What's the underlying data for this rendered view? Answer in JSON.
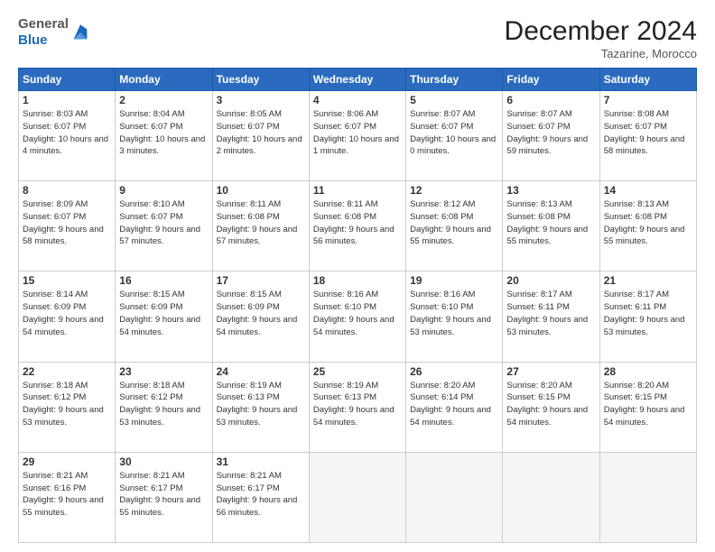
{
  "header": {
    "logo_line1": "General",
    "logo_line2": "Blue",
    "month": "December 2024",
    "location": "Tazarine, Morocco"
  },
  "weekdays": [
    "Sunday",
    "Monday",
    "Tuesday",
    "Wednesday",
    "Thursday",
    "Friday",
    "Saturday"
  ],
  "weeks": [
    [
      {
        "day": 1,
        "sunrise": "8:03 AM",
        "sunset": "6:07 PM",
        "daylight": "10 hours and 4 minutes."
      },
      {
        "day": 2,
        "sunrise": "8:04 AM",
        "sunset": "6:07 PM",
        "daylight": "10 hours and 3 minutes."
      },
      {
        "day": 3,
        "sunrise": "8:05 AM",
        "sunset": "6:07 PM",
        "daylight": "10 hours and 2 minutes."
      },
      {
        "day": 4,
        "sunrise": "8:06 AM",
        "sunset": "6:07 PM",
        "daylight": "10 hours and 1 minute."
      },
      {
        "day": 5,
        "sunrise": "8:07 AM",
        "sunset": "6:07 PM",
        "daylight": "10 hours and 0 minutes."
      },
      {
        "day": 6,
        "sunrise": "8:07 AM",
        "sunset": "6:07 PM",
        "daylight": "9 hours and 59 minutes."
      },
      {
        "day": 7,
        "sunrise": "8:08 AM",
        "sunset": "6:07 PM",
        "daylight": "9 hours and 58 minutes."
      }
    ],
    [
      {
        "day": 8,
        "sunrise": "8:09 AM",
        "sunset": "6:07 PM",
        "daylight": "9 hours and 58 minutes."
      },
      {
        "day": 9,
        "sunrise": "8:10 AM",
        "sunset": "6:07 PM",
        "daylight": "9 hours and 57 minutes."
      },
      {
        "day": 10,
        "sunrise": "8:11 AM",
        "sunset": "6:08 PM",
        "daylight": "9 hours and 57 minutes."
      },
      {
        "day": 11,
        "sunrise": "8:11 AM",
        "sunset": "6:08 PM",
        "daylight": "9 hours and 56 minutes."
      },
      {
        "day": 12,
        "sunrise": "8:12 AM",
        "sunset": "6:08 PM",
        "daylight": "9 hours and 55 minutes."
      },
      {
        "day": 13,
        "sunrise": "8:13 AM",
        "sunset": "6:08 PM",
        "daylight": "9 hours and 55 minutes."
      },
      {
        "day": 14,
        "sunrise": "8:13 AM",
        "sunset": "6:08 PM",
        "daylight": "9 hours and 55 minutes."
      }
    ],
    [
      {
        "day": 15,
        "sunrise": "8:14 AM",
        "sunset": "6:09 PM",
        "daylight": "9 hours and 54 minutes."
      },
      {
        "day": 16,
        "sunrise": "8:15 AM",
        "sunset": "6:09 PM",
        "daylight": "9 hours and 54 minutes."
      },
      {
        "day": 17,
        "sunrise": "8:15 AM",
        "sunset": "6:09 PM",
        "daylight": "9 hours and 54 minutes."
      },
      {
        "day": 18,
        "sunrise": "8:16 AM",
        "sunset": "6:10 PM",
        "daylight": "9 hours and 54 minutes."
      },
      {
        "day": 19,
        "sunrise": "8:16 AM",
        "sunset": "6:10 PM",
        "daylight": "9 hours and 53 minutes."
      },
      {
        "day": 20,
        "sunrise": "8:17 AM",
        "sunset": "6:11 PM",
        "daylight": "9 hours and 53 minutes."
      },
      {
        "day": 21,
        "sunrise": "8:17 AM",
        "sunset": "6:11 PM",
        "daylight": "9 hours and 53 minutes."
      }
    ],
    [
      {
        "day": 22,
        "sunrise": "8:18 AM",
        "sunset": "6:12 PM",
        "daylight": "9 hours and 53 minutes."
      },
      {
        "day": 23,
        "sunrise": "8:18 AM",
        "sunset": "6:12 PM",
        "daylight": "9 hours and 53 minutes."
      },
      {
        "day": 24,
        "sunrise": "8:19 AM",
        "sunset": "6:13 PM",
        "daylight": "9 hours and 53 minutes."
      },
      {
        "day": 25,
        "sunrise": "8:19 AM",
        "sunset": "6:13 PM",
        "daylight": "9 hours and 54 minutes."
      },
      {
        "day": 26,
        "sunrise": "8:20 AM",
        "sunset": "6:14 PM",
        "daylight": "9 hours and 54 minutes."
      },
      {
        "day": 27,
        "sunrise": "8:20 AM",
        "sunset": "6:15 PM",
        "daylight": "9 hours and 54 minutes."
      },
      {
        "day": 28,
        "sunrise": "8:20 AM",
        "sunset": "6:15 PM",
        "daylight": "9 hours and 54 minutes."
      }
    ],
    [
      {
        "day": 29,
        "sunrise": "8:21 AM",
        "sunset": "6:16 PM",
        "daylight": "9 hours and 55 minutes."
      },
      {
        "day": 30,
        "sunrise": "8:21 AM",
        "sunset": "6:17 PM",
        "daylight": "9 hours and 55 minutes."
      },
      {
        "day": 31,
        "sunrise": "8:21 AM",
        "sunset": "6:17 PM",
        "daylight": "9 hours and 56 minutes."
      },
      null,
      null,
      null,
      null
    ]
  ]
}
